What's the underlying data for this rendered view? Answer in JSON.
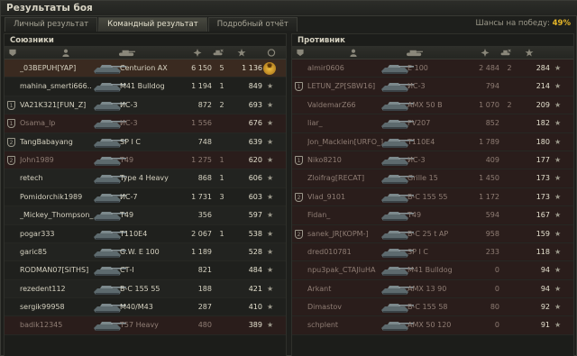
{
  "window": {
    "title": "Результаты боя"
  },
  "tabs": [
    {
      "label": "Личный результат"
    },
    {
      "label": "Командный результат"
    },
    {
      "label": "Подробный отчёт"
    }
  ],
  "win_chance": {
    "label": "Шансы на победу:",
    "value": "49%"
  },
  "allies": {
    "title": "Союзники",
    "rows": [
      {
        "squad": "",
        "name": "_03ВЕРUН[YAP]",
        "vehicle": "Centurion AX",
        "damage": "6 150",
        "kills": "5",
        "xp": "1 136",
        "dead": false,
        "highlight": true,
        "medal": true
      },
      {
        "squad": "",
        "name": "mahina_smerti666..",
        "vehicle": "M41 Bulldog",
        "damage": "1 194",
        "kills": "1",
        "xp": "849",
        "dead": false
      },
      {
        "squad": "1",
        "name": "VA21K321[FUN_Z]",
        "vehicle": "ИС-3",
        "damage": "872",
        "kills": "2",
        "xp": "693",
        "dead": false
      },
      {
        "squad": "1",
        "name": "Osama_lp",
        "vehicle": "ИС-3",
        "damage": "1 556",
        "kills": "",
        "xp": "676",
        "dead": true
      },
      {
        "squad": "2",
        "name": "TangBabayang",
        "vehicle": "SP I C",
        "damage": "748",
        "kills": "",
        "xp": "639",
        "dead": false
      },
      {
        "squad": "2",
        "name": "John1989",
        "vehicle": "T49",
        "damage": "1 275",
        "kills": "1",
        "xp": "620",
        "dead": true
      },
      {
        "squad": "",
        "name": "retech",
        "vehicle": "Type 4 Heavy",
        "damage": "868",
        "kills": "1",
        "xp": "606",
        "dead": false
      },
      {
        "squad": "",
        "name": "Pomidorchik1989",
        "vehicle": "ИС-7",
        "damage": "1 731",
        "kills": "3",
        "xp": "603",
        "dead": false
      },
      {
        "squad": "",
        "name": "_Mickey_Thompson_",
        "vehicle": "T49",
        "damage": "356",
        "kills": "",
        "xp": "597",
        "dead": false
      },
      {
        "squad": "",
        "name": "pogar333",
        "vehicle": "T110E4",
        "damage": "2 067",
        "kills": "1",
        "xp": "538",
        "dead": false
      },
      {
        "squad": "",
        "name": "garic85",
        "vehicle": "G.W. E 100",
        "damage": "1 189",
        "kills": "",
        "xp": "528",
        "dead": false
      },
      {
        "squad": "",
        "name": "RODMAN07[SITHS]",
        "vehicle": "СТ-I",
        "damage": "821",
        "kills": "",
        "xp": "484",
        "dead": false
      },
      {
        "squad": "",
        "name": "rezedent112",
        "vehicle": "B-C 155 55",
        "damage": "188",
        "kills": "",
        "xp": "421",
        "dead": false
      },
      {
        "squad": "",
        "name": "sergik99958",
        "vehicle": "M40/M43",
        "damage": "287",
        "kills": "",
        "xp": "410",
        "dead": false
      },
      {
        "squad": "",
        "name": "badik12345",
        "vehicle": "T57 Heavy",
        "damage": "480",
        "kills": "",
        "xp": "389",
        "dead": true
      }
    ]
  },
  "enemies": {
    "title": "Противник",
    "rows": [
      {
        "squad": "",
        "name": "almir0606",
        "vehicle": "E 100",
        "damage": "2 484",
        "kills": "2",
        "xp": "284",
        "dead": true
      },
      {
        "squad": "1",
        "name": "LETUN_ZP[SBW16]",
        "vehicle": "ИС-3",
        "damage": "794",
        "kills": "",
        "xp": "214",
        "dead": true
      },
      {
        "squad": "",
        "name": "ValdemarZ66",
        "vehicle": "AMX 50 B",
        "damage": "1 070",
        "kills": "2",
        "xp": "209",
        "dead": true
      },
      {
        "squad": "",
        "name": "liar_",
        "vehicle": "FV207",
        "damage": "852",
        "kills": "",
        "xp": "182",
        "dead": true
      },
      {
        "squad": "",
        "name": "Jon_Macklein[URFO_]",
        "vehicle": "T110E4",
        "damage": "1 789",
        "kills": "",
        "xp": "180",
        "dead": true
      },
      {
        "squad": "1",
        "name": "Niko8210",
        "vehicle": "ИС-3",
        "damage": "409",
        "kills": "",
        "xp": "177",
        "dead": true
      },
      {
        "squad": "",
        "name": "Zloifrag[RECAT]",
        "vehicle": "Grille 15",
        "damage": "1 450",
        "kills": "",
        "xp": "173",
        "dead": true
      },
      {
        "squad": "2",
        "name": "Vlad_9101",
        "vehicle": "B-C 155 55",
        "damage": "1 172",
        "kills": "",
        "xp": "173",
        "dead": true
      },
      {
        "squad": "",
        "name": "Fidan_",
        "vehicle": "T49",
        "damage": "594",
        "kills": "",
        "xp": "167",
        "dead": true
      },
      {
        "squad": "2",
        "name": "sanek_JR[KOPM-]",
        "vehicle": "B-C 25 t AP",
        "damage": "958",
        "kills": "",
        "xp": "159",
        "dead": true
      },
      {
        "squad": "",
        "name": "dred010781",
        "vehicle": "SP I C",
        "damage": "233",
        "kills": "",
        "xp": "118",
        "dead": true
      },
      {
        "squad": "",
        "name": "npu3pak_CTAJIuHA",
        "vehicle": "M41 Bulldog",
        "damage": "0",
        "kills": "",
        "xp": "94",
        "dead": true
      },
      {
        "squad": "",
        "name": "Arkant",
        "vehicle": "AMX 13 90",
        "damage": "0",
        "kills": "",
        "xp": "94",
        "dead": true
      },
      {
        "squad": "",
        "name": "Dimastov",
        "vehicle": "B-C 155 58",
        "damage": "80",
        "kills": "",
        "xp": "92",
        "dead": true
      },
      {
        "squad": "",
        "name": "schplent",
        "vehicle": "AMX 50 120",
        "damage": "0",
        "kills": "",
        "xp": "91",
        "dead": true
      }
    ]
  },
  "icons": {
    "header": [
      "squad-icon",
      "player-icon",
      "vehicle-icon",
      "damage-icon",
      "kills-icon",
      "xp-icon",
      "medal-icon"
    ]
  }
}
